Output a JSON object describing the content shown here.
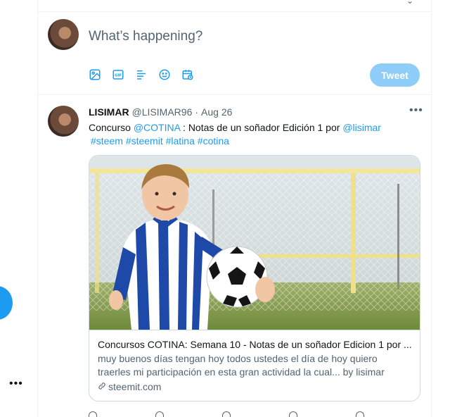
{
  "compose": {
    "placeholder": "What’s happening?",
    "tools": [
      "image-icon",
      "gif-icon",
      "poll-icon",
      "emoji-icon",
      "schedule-icon"
    ],
    "tweet_label": "Tweet"
  },
  "tweet": {
    "name": "LISIMAR",
    "handle": "@LISIMAR96",
    "separator": "·",
    "date": "Aug 26",
    "text_prefix": "Concurso ",
    "mention_cotina": "@COTINA",
    "text_middle": " : Notas de un soñador Edición 1 por ",
    "mention_lisimar": "@lisimar",
    "hashtags": [
      "#steem",
      "#steemit",
      "#latina",
      "#cotina"
    ],
    "card": {
      "title": "Concursos COTINA: Semana 10 - Notas de un soñador Edicion 1 por ...",
      "description": "muy buenos días tengan hoy todos ustedes el día de hoy quiero traerles mi participación en esta gran actividad la cual... by lisimar",
      "domain": "steemit.com"
    }
  },
  "colors": {
    "accent": "#1d9bf0",
    "tweet_button_disabled": "#8ecdf8",
    "text_secondary": "#536471",
    "divider": "#eff3f4"
  }
}
